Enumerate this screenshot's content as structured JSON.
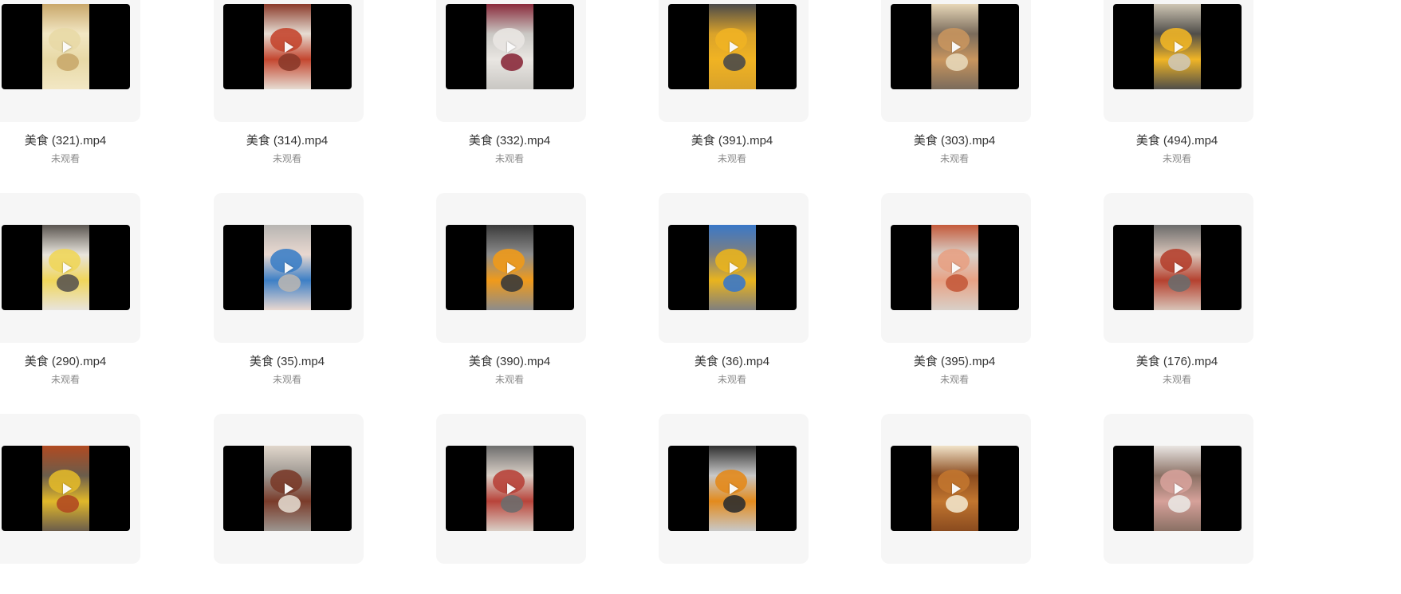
{
  "videos": [
    {
      "name": "美食 (321).mp4",
      "status": "未观看",
      "colors": [
        "#e8d9a6",
        "#c9a86b",
        "#f2e7c4"
      ]
    },
    {
      "name": "美食 (314).mp4",
      "status": "未观看",
      "colors": [
        "#c4462f",
        "#8b3a2a",
        "#e6dcd2"
      ]
    },
    {
      "name": "美食 (332).mp4",
      "status": "未观看",
      "colors": [
        "#e9e6e2",
        "#8a2a3b",
        "#c9c7c3"
      ]
    },
    {
      "name": "美食 (391).mp4",
      "status": "未观看",
      "colors": [
        "#f0b323",
        "#4a4a4a",
        "#d9a22a"
      ]
    },
    {
      "name": "美食 (303).mp4",
      "status": "未观看",
      "colors": [
        "#c8955e",
        "#e7d7b8",
        "#7a6b5b"
      ]
    },
    {
      "name": "美食 (494).mp4",
      "status": "未观看",
      "colors": [
        "#f0b526",
        "#cfc6b4",
        "#4f4d49"
      ]
    },
    {
      "name": "美食 (290).mp4",
      "status": "未观看",
      "colors": [
        "#f0d65a",
        "#5a5550",
        "#e8e4dc"
      ]
    },
    {
      "name": "美食 (35).mp4",
      "status": "未观看",
      "colors": [
        "#3d7fc6",
        "#b7b5b2",
        "#e9d8d0"
      ]
    },
    {
      "name": "美食 (390).mp4",
      "status": "未观看",
      "colors": [
        "#f09a1a",
        "#3a3a3a",
        "#8c8c8c"
      ]
    },
    {
      "name": "美食 (36).mp4",
      "status": "未观看",
      "colors": [
        "#e9b41e",
        "#3a78c8",
        "#7f7f7f"
      ]
    },
    {
      "name": "美食 (395).mp4",
      "status": "未观看",
      "colors": [
        "#e7a184",
        "#c45a3b",
        "#d9d0c8"
      ]
    },
    {
      "name": "美食 (176).mp4",
      "status": "未观看",
      "colors": [
        "#b5412f",
        "#6b6b6b",
        "#d8c4b8"
      ]
    },
    {
      "name": "",
      "status": "",
      "colors": [
        "#e1b82a",
        "#b14a21",
        "#6b5d4b"
      ]
    },
    {
      "name": "",
      "status": "",
      "colors": [
        "#7a3b2a",
        "#e1d7cc",
        "#9c9690"
      ]
    },
    {
      "name": "",
      "status": "",
      "colors": [
        "#b8433a",
        "#6d6d6d",
        "#d9cfc6"
      ]
    },
    {
      "name": "",
      "status": "",
      "colors": [
        "#e38a1c",
        "#2f2f2f",
        "#c8c8c8"
      ]
    },
    {
      "name": "",
      "status": "",
      "colors": [
        "#c2762f",
        "#f1e3c9",
        "#8a4b1f"
      ]
    },
    {
      "name": "",
      "status": "",
      "colors": [
        "#d6a19a",
        "#e9e5e2",
        "#8a7064"
      ]
    }
  ],
  "icons": {
    "play": "play-icon"
  }
}
